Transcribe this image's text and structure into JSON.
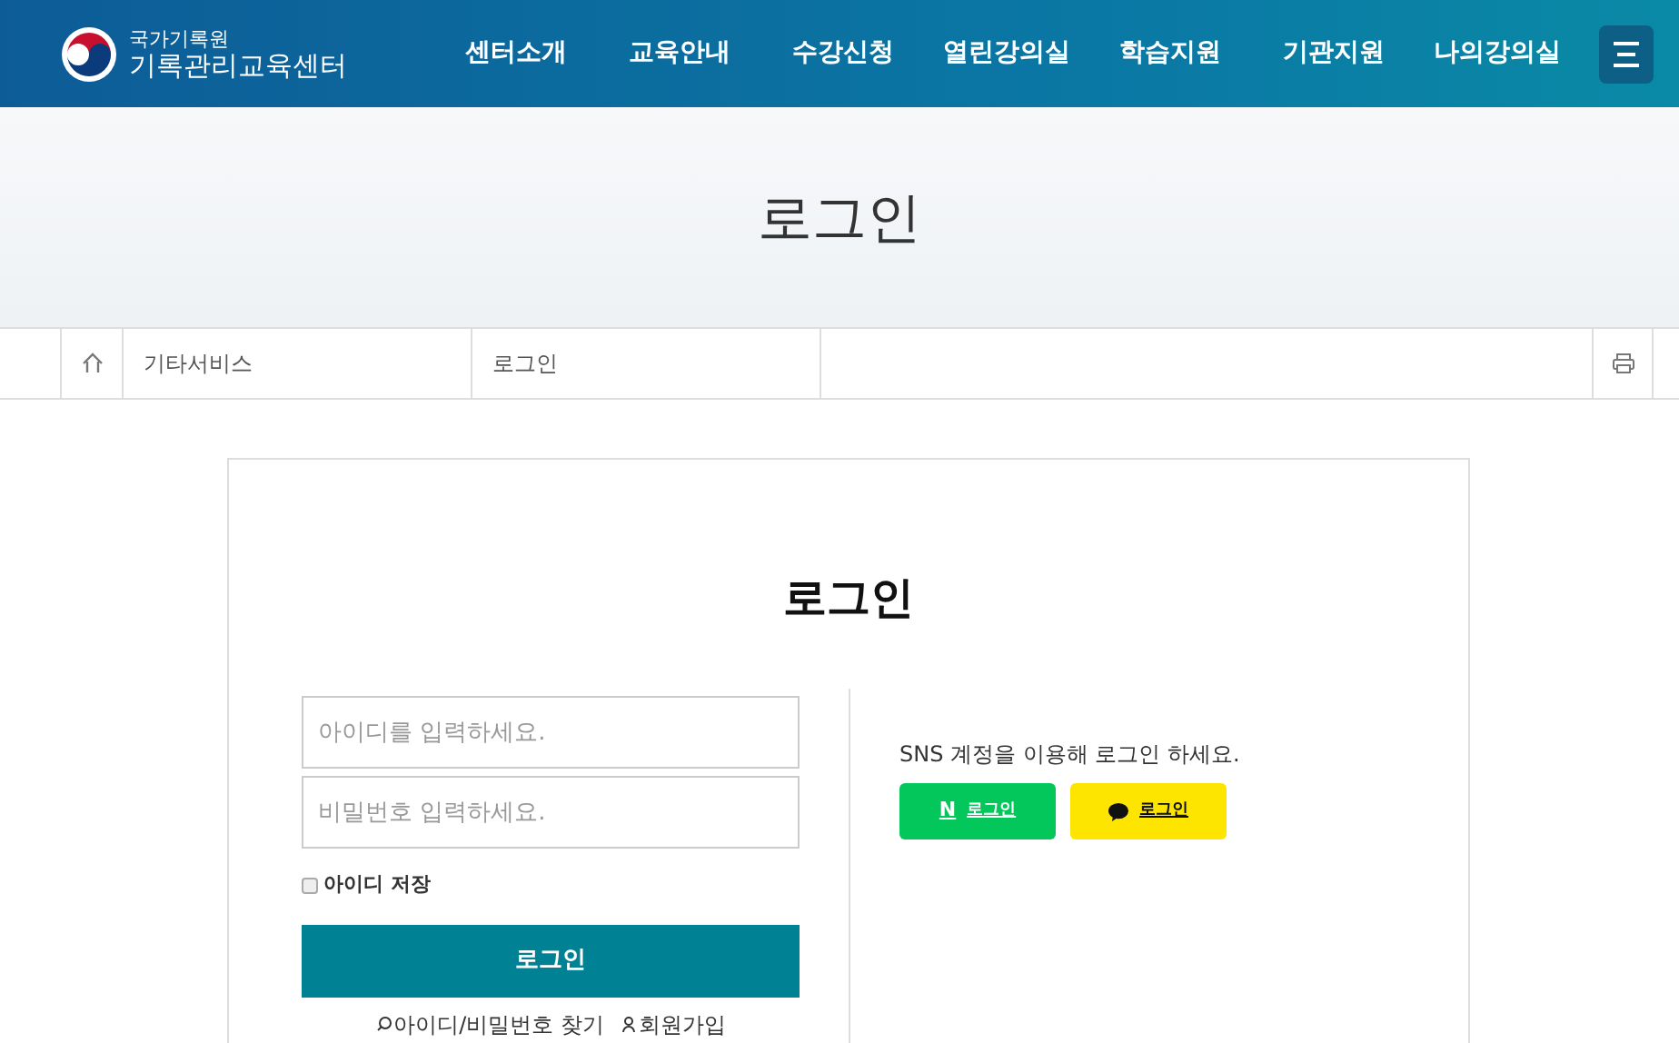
{
  "header": {
    "logo_small": "국가기록원",
    "logo_large": "기록관리교육센터",
    "nav": [
      "센터소개",
      "교육안내",
      "수강신청",
      "열린강의실",
      "학습지원",
      "기관지원",
      "나의강의실"
    ]
  },
  "page_title": "로그인",
  "breadcrumb": [
    "기타서비스",
    "로그인"
  ],
  "login": {
    "title": "로그인",
    "id_placeholder": "아이디를 입력하세요.",
    "password_placeholder": "비밀번호 입력하세요.",
    "remember": {
      "label": "아이디 저장",
      "checked": false
    },
    "submit": "로그인",
    "links": [
      {
        "kind": "find",
        "label": "아이디/비밀번호 찾기"
      },
      {
        "kind": "join",
        "label": "회원가입"
      }
    ],
    "sns_text": "SNS 계정을 이용해 로그인 하세요.",
    "sns": [
      {
        "kind": "naver",
        "mark": "N",
        "label": "로그인"
      },
      {
        "kind": "kakao",
        "label": "로그인"
      }
    ]
  }
}
